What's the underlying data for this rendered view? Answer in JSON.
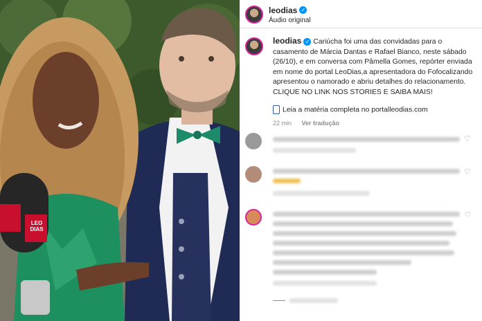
{
  "post": {
    "username": "leodias",
    "audio_label": "Áudio original",
    "caption": "Cariúcha foi uma das convidadas para o casamento de Márcia Dantas e Rafael Bianco, neste sábado (26/10), e em conversa com Pâmella Gomes, repórter enviada em nome do portal LeoDias,a apresentadora do Fofocalizando apresentou o namorado e abriu detalhes do relacionamento. CLIQUE NO LINK NOS STORIES E SAIBA MAIS!",
    "link_line": "Leia a matéria completa no portalleodias.com",
    "time_ago": "22 min",
    "translate_label": "Ver tradução"
  },
  "photo": {
    "mic_logo_text": "LEO DIAS"
  },
  "colors": {
    "verified": "#0095f6",
    "avatar_ring": "#d6249f"
  }
}
